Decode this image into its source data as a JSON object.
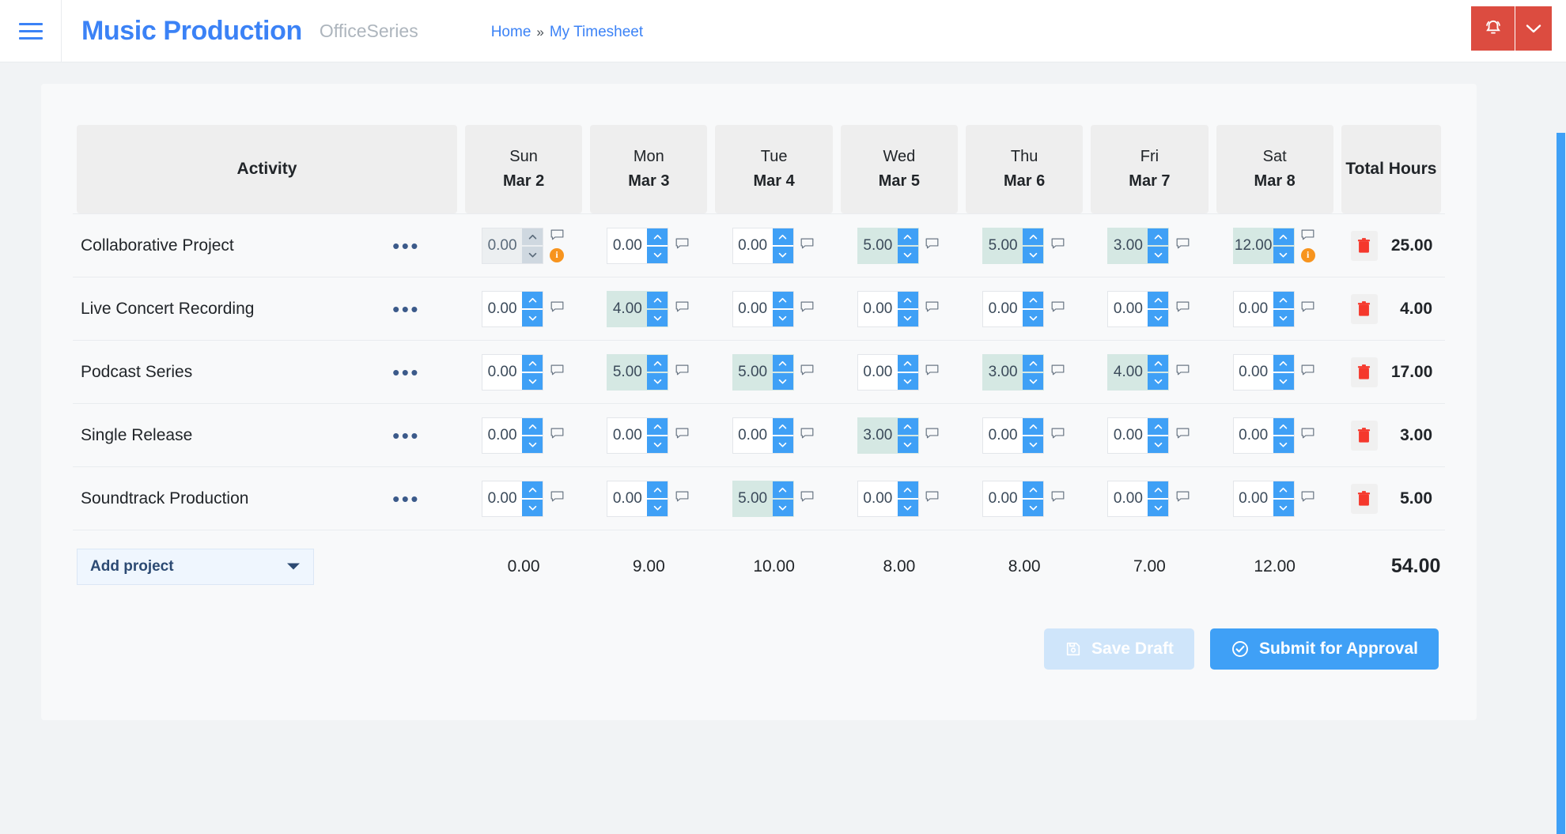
{
  "topbar": {
    "menu_icon": "hamburger-icon",
    "brand": "Music Production",
    "brand_sub": "OfficeSeries",
    "breadcrumb": {
      "home": "Home",
      "separator": "»",
      "current": "My Timesheet"
    },
    "bell_icon": "bell-icon",
    "caret_icon": "chevron-down-icon",
    "accent_red": "#dc4c40",
    "accent_blue": "#3b82f6"
  },
  "table": {
    "activity_header": "Activity",
    "total_header": "Total Hours",
    "days": [
      {
        "dow": "Sun",
        "date": "Mar 2"
      },
      {
        "dow": "Mon",
        "date": "Mar 3"
      },
      {
        "dow": "Tue",
        "date": "Mar 4"
      },
      {
        "dow": "Wed",
        "date": "Mar 5"
      },
      {
        "dow": "Thu",
        "date": "Mar 6"
      },
      {
        "dow": "Fri",
        "date": "Mar 7"
      },
      {
        "dow": "Sat",
        "date": "Mar 8"
      }
    ],
    "rows": [
      {
        "activity": "Collaborative Project",
        "values": [
          "0.00",
          "0.00",
          "0.00",
          "5.00",
          "5.00",
          "3.00",
          "12.00"
        ],
        "disabled": [
          true,
          false,
          false,
          false,
          false,
          false,
          false
        ],
        "info": [
          true,
          false,
          false,
          false,
          false,
          false,
          true
        ],
        "total": "25.00"
      },
      {
        "activity": "Live Concert Recording",
        "values": [
          "0.00",
          "4.00",
          "0.00",
          "0.00",
          "0.00",
          "0.00",
          "0.00"
        ],
        "disabled": [
          false,
          false,
          false,
          false,
          false,
          false,
          false
        ],
        "info": [
          false,
          false,
          false,
          false,
          false,
          false,
          false
        ],
        "total": "4.00"
      },
      {
        "activity": "Podcast Series",
        "values": [
          "0.00",
          "5.00",
          "5.00",
          "0.00",
          "3.00",
          "4.00",
          "0.00"
        ],
        "disabled": [
          false,
          false,
          false,
          false,
          false,
          false,
          false
        ],
        "info": [
          false,
          false,
          false,
          false,
          false,
          false,
          false
        ],
        "total": "17.00"
      },
      {
        "activity": "Single Release",
        "values": [
          "0.00",
          "0.00",
          "0.00",
          "3.00",
          "0.00",
          "0.00",
          "0.00"
        ],
        "disabled": [
          false,
          false,
          false,
          false,
          false,
          false,
          false
        ],
        "info": [
          false,
          false,
          false,
          false,
          false,
          false,
          false
        ],
        "total": "3.00"
      },
      {
        "activity": "Soundtrack Production",
        "values": [
          "0.00",
          "0.00",
          "5.00",
          "0.00",
          "0.00",
          "0.00",
          "0.00"
        ],
        "disabled": [
          false,
          false,
          false,
          false,
          false,
          false,
          false
        ],
        "info": [
          false,
          false,
          false,
          false,
          false,
          false,
          false
        ],
        "total": "5.00"
      }
    ],
    "column_totals": [
      "0.00",
      "9.00",
      "10.00",
      "8.00",
      "8.00",
      "7.00",
      "12.00"
    ],
    "grand_total": "54.00",
    "row_menu_glyph": "•••",
    "delete_icon": "trash-icon",
    "note_icon": "comment-icon",
    "info_icon": "info-icon",
    "spinner_up_icon": "chevron-up-icon",
    "spinner_down_icon": "chevron-down-icon"
  },
  "footer": {
    "add_project_label": "Add project",
    "add_project_caret": "caret-down-icon",
    "save_draft_label": "Save Draft",
    "save_draft_icon": "save-icon",
    "submit_label": "Submit for Approval",
    "submit_icon": "check-circle-icon"
  },
  "colors": {
    "filled_cell": "#d5e8e3",
    "spinner_blue": "#3fa0f6",
    "info_orange": "#f7941e",
    "delete_red": "#f5382c",
    "page_bg": "#f1f3f5",
    "card_bg": "#f8f9fa",
    "header_cell_bg": "#eeeeee"
  }
}
